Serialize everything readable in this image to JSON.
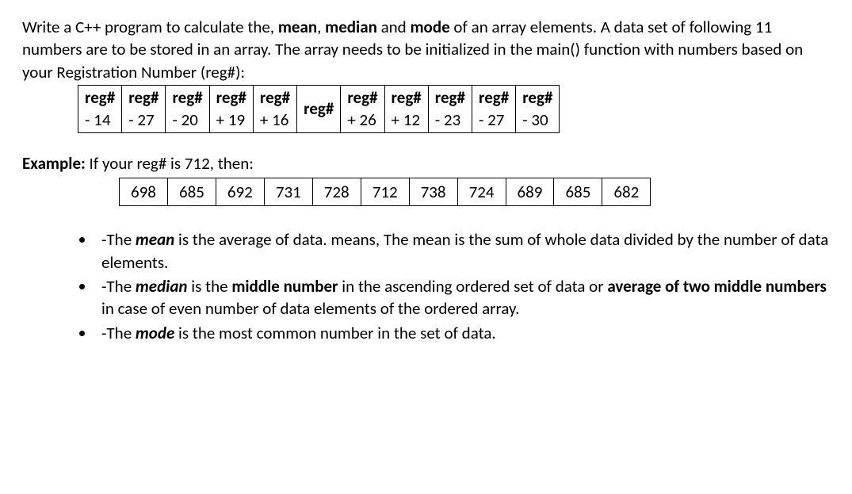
{
  "intro": {
    "l1a": "Write a C++ program to calculate the, ",
    "l1b_mean": "mean",
    "l1c": ", ",
    "l1d_median": "median",
    "l1e": " and ",
    "l1f_mode": "mode",
    "l1g": " of an array elements. A data set of following 11 numbers are to be stored in an array. The array needs to be initialized in the main() function with numbers based on your Registration Number (reg#):"
  },
  "table1": {
    "header_label": "reg#",
    "offsets": [
      "- 14",
      "- 27",
      "- 20",
      "+ 19",
      "+ 16",
      "",
      "+ 26",
      "+ 12",
      "- 23",
      "- 27",
      "- 30"
    ],
    "center_label": "reg#"
  },
  "example": {
    "label_a": "Example:",
    "label_b": " If your reg# is 712, then:",
    "values": [
      "698",
      "685",
      "692",
      "731",
      "728",
      "712",
      "738",
      "724",
      "689",
      "685",
      "682"
    ]
  },
  "bullets": {
    "b1a": "-The ",
    "b1_mean": "mean",
    "b1b": " is the average of data. means, The mean is the sum of whole data divided by the number of data elements.",
    "b2a": "-The ",
    "b2_median": "median",
    "b2b": " is the ",
    "b2_mid": "middle number",
    "b2c": " in the ascending ordered set of data or ",
    "b2_avg": "average of two middle numbers",
    "b2d": " in case of even number of data elements of the ordered array.",
    "b3a": "-The ",
    "b3_mode": "mode",
    "b3b": " is the most common number in the set of data."
  },
  "chart_data": {
    "type": "table",
    "title": "Array offsets relative to reg# and example values for reg#=712",
    "offsets_from_reg": [
      -14,
      -27,
      -20,
      19,
      16,
      0,
      26,
      12,
      -23,
      -27,
      -30
    ],
    "example_reg": 712,
    "example_values": [
      698,
      685,
      692,
      731,
      728,
      712,
      738,
      724,
      689,
      685,
      682
    ]
  }
}
